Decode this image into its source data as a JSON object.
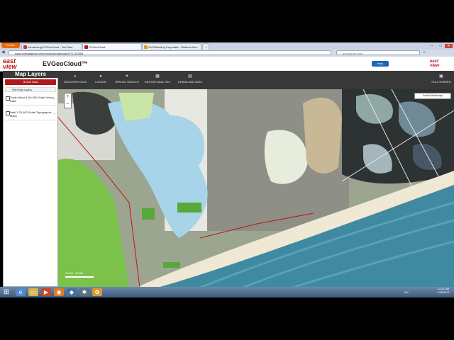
{
  "browser": {
    "firefox_label": "Firefox",
    "tabs": [
      {
        "label": "Introducing EVGeoCloud - YouTube"
      },
      {
        "label": "EVGeoCloud"
      },
      {
        "label": "GoToMeeting Corporate - Webinar Ma..."
      }
    ],
    "new_tab": "+",
    "address": "www.cartographic.com/evcloud/map/map/2071.3CB0#",
    "search_placeholder": "geoedgoer login",
    "window_controls": [
      "–",
      "□",
      "✕"
    ]
  },
  "app": {
    "logo_line1": "east",
    "logo_line2": "view",
    "title": "EVGeoCloud™",
    "help_label": "Help",
    "logo_right_line1": "east",
    "logo_right_line2": "view"
  },
  "sidebar": {
    "title": "Map Layers",
    "add_data": "Add Data",
    "filter_label": "Filter Map Layers",
    "layers": [
      {
        "label": "South Africa 1:50,000 Scale Vector Data"
      },
      {
        "label": "Haiti 1:25,000 Scale Topographic Maps"
      }
    ]
  },
  "toolbar": {
    "items": [
      {
        "label": "DISCOVER DATA",
        "icon": "magnifier-icon"
      },
      {
        "label": "LOCATE",
        "icon": "pin-icon"
      },
      {
        "label": "SPATIAL SEARCH",
        "icon": "spatial-icon"
      },
      {
        "label": "RASTER ANALYSIS",
        "icon": "raster-icon"
      },
      {
        "label": "DOWNLOAD DATA",
        "icon": "download-icon"
      },
      {
        "label": "FULL SCREEN",
        "icon": "fullscreen-icon"
      }
    ]
  },
  "map": {
    "basemap_label": "Switch Basemap",
    "zoom_in": "+",
    "zoom_out": "–",
    "coords": "99.024 · 34.082"
  },
  "taskbar": {
    "tray": "EN",
    "time": "12:21 AM",
    "date": "4/26/2013"
  },
  "colors": {
    "brand_red": "#c0141b",
    "toolbar_bg": "#383838",
    "help_blue": "#1f67b8",
    "water": "#a8d4ea",
    "ocean": "#3f8aa1"
  }
}
